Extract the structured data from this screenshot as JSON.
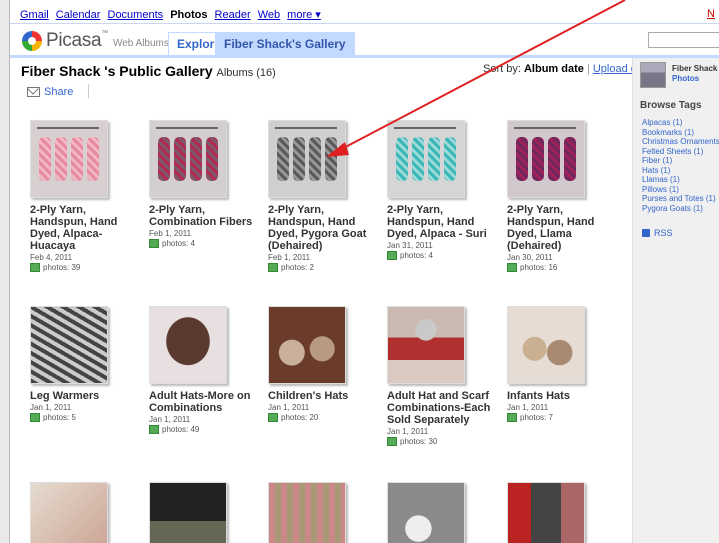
{
  "gbar": {
    "items": [
      "Gmail",
      "Calendar",
      "Documents",
      "Photos",
      "Reader",
      "Web",
      "more ▾"
    ],
    "current": "Photos",
    "right_link": "N"
  },
  "header": {
    "logo_text": "Picasa",
    "logo_tm": "™",
    "logo_sub": "Web Albums",
    "tabs": [
      "Explore",
      "Fiber Shack's Gallery"
    ]
  },
  "gallery": {
    "title": "Fiber Shack 's Public Gallery",
    "subtitle": "Albums (16)",
    "sort_label": "Sort by:",
    "sort_value": "Album date",
    "upload_link": "Upload date",
    "share_label": "Share"
  },
  "albums": [
    {
      "title": "2-Ply Yarn, Handspun, Hand Dyed, Alpaca-Huacaya",
      "date": "Feb 4, 2011",
      "photos": "photos: 39"
    },
    {
      "title": "2-Ply Yarn, Combination Fibers",
      "date": "Feb 1, 2011",
      "photos": "photos: 4"
    },
    {
      "title": "2-Ply Yarn, Handspun, Hand Dyed, Pygora Goat (Dehaired)",
      "date": "Feb 1, 2011",
      "photos": "photos: 2"
    },
    {
      "title": "2-Ply Yarn, Handspun, Hand Dyed, Alpaca - Suri",
      "date": "Jan 31, 2011",
      "photos": "photos: 4"
    },
    {
      "title": "2-Ply Yarn, Handspun, Hand Dyed, Llama (Dehaired)",
      "date": "Jan 30, 2011",
      "photos": "photos: 16"
    },
    {
      "title": "Leg Warmers",
      "date": "Jan 1, 2011",
      "photos": "photos: 5"
    },
    {
      "title": "Adult Hats-More on Combinations",
      "date": "Jan 1, 2011",
      "photos": "photos: 49"
    },
    {
      "title": "Children's Hats",
      "date": "Jan 1, 2011",
      "photos": "photos: 20"
    },
    {
      "title": "Adult Hat and Scarf Combinations-Each Sold Separately",
      "date": "Jan 1, 2011",
      "photos": "photos: 30"
    },
    {
      "title": "Infants Hats",
      "date": "Jan 1, 2011",
      "photos": "photos: 7"
    }
  ],
  "sidebar": {
    "user_name": "Fiber Shack",
    "user_link": "Photos",
    "tags_heading": "Browse Tags",
    "tags": [
      "Alpacas (1)",
      "Bookmarks (1)",
      "Christmas Ornaments",
      "Felted Sheets (1)",
      "Fiber (1)",
      "Hats (1)",
      "Llamas (1)",
      "Pillows (1)",
      "Purses and Totes (1)",
      "Pygora Goats (1)"
    ],
    "rss_label": "RSS"
  },
  "colors": {
    "link": "#3366cc",
    "tab_bg": "#c3d9ff",
    "annotation_arrow": "#e02020"
  }
}
